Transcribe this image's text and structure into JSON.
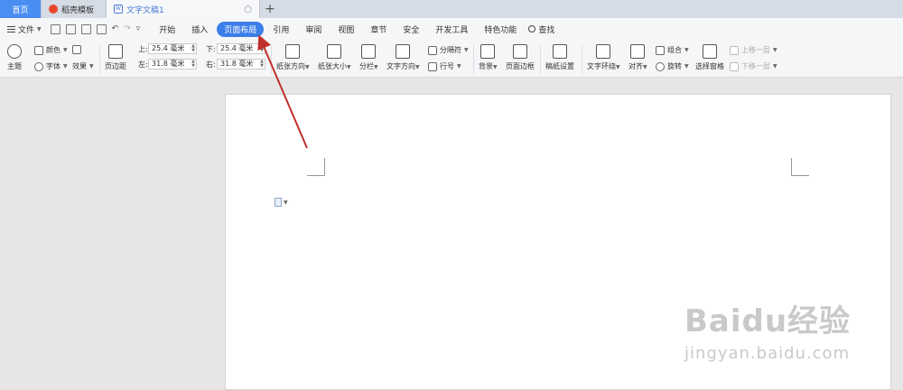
{
  "tabs": {
    "home": "首页",
    "template": "稻壳模板",
    "document": "文字文稿1",
    "add": "+"
  },
  "menu": {
    "file": "文件",
    "items": [
      "开始",
      "插入",
      "页面布局",
      "引用",
      "审阅",
      "视图",
      "章节",
      "安全",
      "开发工具",
      "特色功能"
    ],
    "active_index": 2,
    "search": "查找"
  },
  "ribbon": {
    "theme": {
      "colors": "颜色",
      "fonts": "字体",
      "effects": "效果",
      "theme": "主题"
    },
    "margins": "页边距",
    "margin_fields": {
      "top_label": "上:",
      "top_value": "25.4 毫米",
      "bottom_label": "下:",
      "bottom_value": "25.4 毫米",
      "left_label": "左:",
      "left_value": "31.8 毫米",
      "right_label": "右:",
      "right_value": "31.8 毫米"
    },
    "orientation": "纸张方向",
    "size": "纸张大小",
    "columns": "分栏",
    "text_direction": "文字方向",
    "breaks": "分隔符",
    "line_numbers": "行号",
    "background": "背景",
    "page_border": "页面边框",
    "manuscript": "稿纸设置",
    "text_wrap": "文字环绕",
    "align": "对齐",
    "group": "组合",
    "rotate": "旋转",
    "select_pane": "选择窗格",
    "bring_forward": "上移一层",
    "send_backward": "下移一层"
  },
  "watermark": {
    "brand": "Baidu经验",
    "url": "jingyan.baidu.com"
  },
  "colors": {
    "accent": "#3c7ee8",
    "annotation_arrow": "#c0302a"
  }
}
